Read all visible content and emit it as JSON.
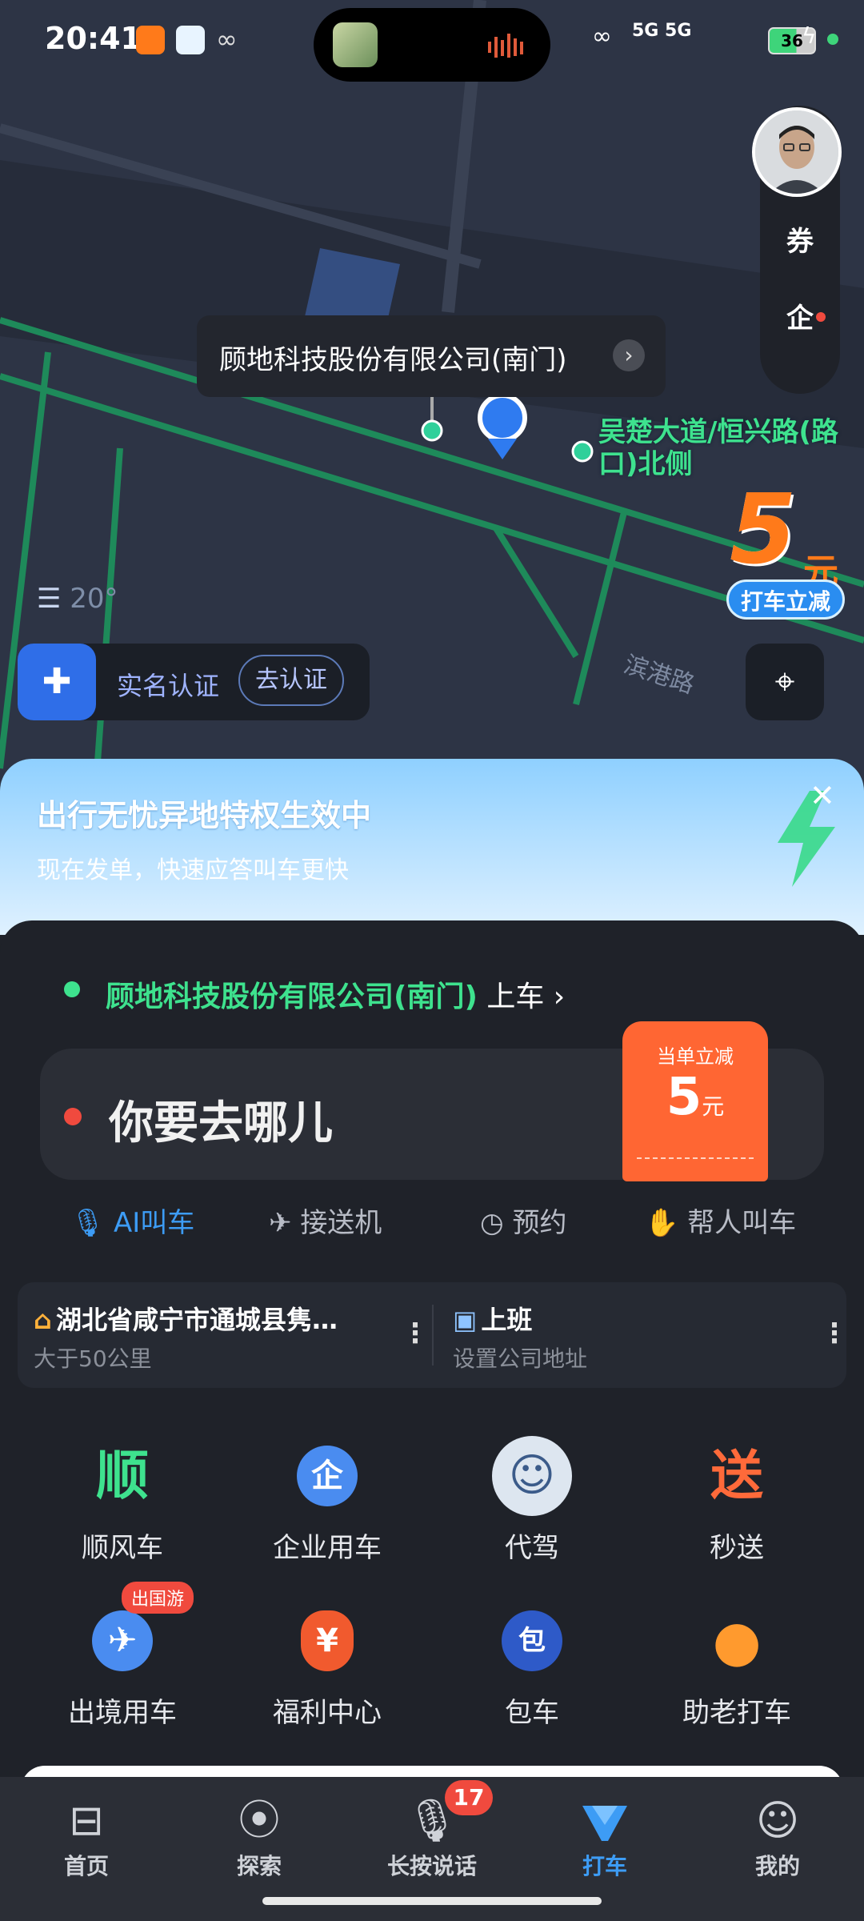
{
  "status_bar": {
    "time": "20:41",
    "battery": "36",
    "network": "5G 5G"
  },
  "map": {
    "poi_name": "顾地科技股份有限公司(南门)",
    "road_label": "吴楚大道/恒兴路(路口)北侧",
    "street_name": "滨港路",
    "temperature": "20°",
    "promo": {
      "amount": "5",
      "unit": "元",
      "tag": "打车立减"
    },
    "side_buttons": [
      "券",
      "企"
    ]
  },
  "verify": {
    "text": "实名认证",
    "button": "去认证"
  },
  "banner": {
    "title": "出行无忧异地特权生效中",
    "subtitle": "现在发单，快速应答叫车更快"
  },
  "panel": {
    "pickup_name": "顾地科技股份有限公司(南门)",
    "pickup_suffix": " 上车 ›",
    "destination_placeholder": "你要去哪儿",
    "coupon": {
      "label": "当单立减",
      "value": "5",
      "unit": "元"
    },
    "modes": [
      {
        "label": "AI叫车",
        "icon": "microphone-icon"
      },
      {
        "label": "接送机",
        "icon": "airplane-icon"
      },
      {
        "label": "预约",
        "icon": "clock-icon"
      },
      {
        "label": "帮人叫车",
        "icon": "handshake-icon"
      }
    ],
    "shortcuts": [
      {
        "title": "湖北省咸宁市通城县隽…",
        "sub": "大于50公里",
        "icon": "home-icon"
      },
      {
        "title": "上班",
        "sub": "设置公司地址",
        "icon": "briefcase-icon"
      }
    ],
    "services": [
      {
        "label": "顺风车",
        "glyph": "顺"
      },
      {
        "label": "企业用车",
        "glyph": "企"
      },
      {
        "label": "代驾",
        "glyph": "☺"
      },
      {
        "label": "秒送",
        "glyph": "送"
      },
      {
        "label": "出境用车",
        "glyph": "✈"
      },
      {
        "label": "福利中心",
        "glyph": "¥"
      },
      {
        "label": "包车",
        "glyph": "包"
      },
      {
        "label": "助老打车",
        "glyph": "●"
      }
    ],
    "abroad_badge": "出国游"
  },
  "nav": {
    "items": [
      {
        "label": "首页",
        "icon": "bus-icon"
      },
      {
        "label": "探索",
        "icon": "location-pin-icon"
      },
      {
        "label": "长按说话",
        "icon": "microphone-icon"
      },
      {
        "label": "打车",
        "icon": "taxi-icon"
      },
      {
        "label": "我的",
        "icon": "person-icon"
      }
    ],
    "badge": "17",
    "active_index": 3
  },
  "colors": {
    "accent": "#3d9cf5",
    "green": "#3ee28e",
    "orange": "#ff6633",
    "red": "#f04a3e"
  }
}
